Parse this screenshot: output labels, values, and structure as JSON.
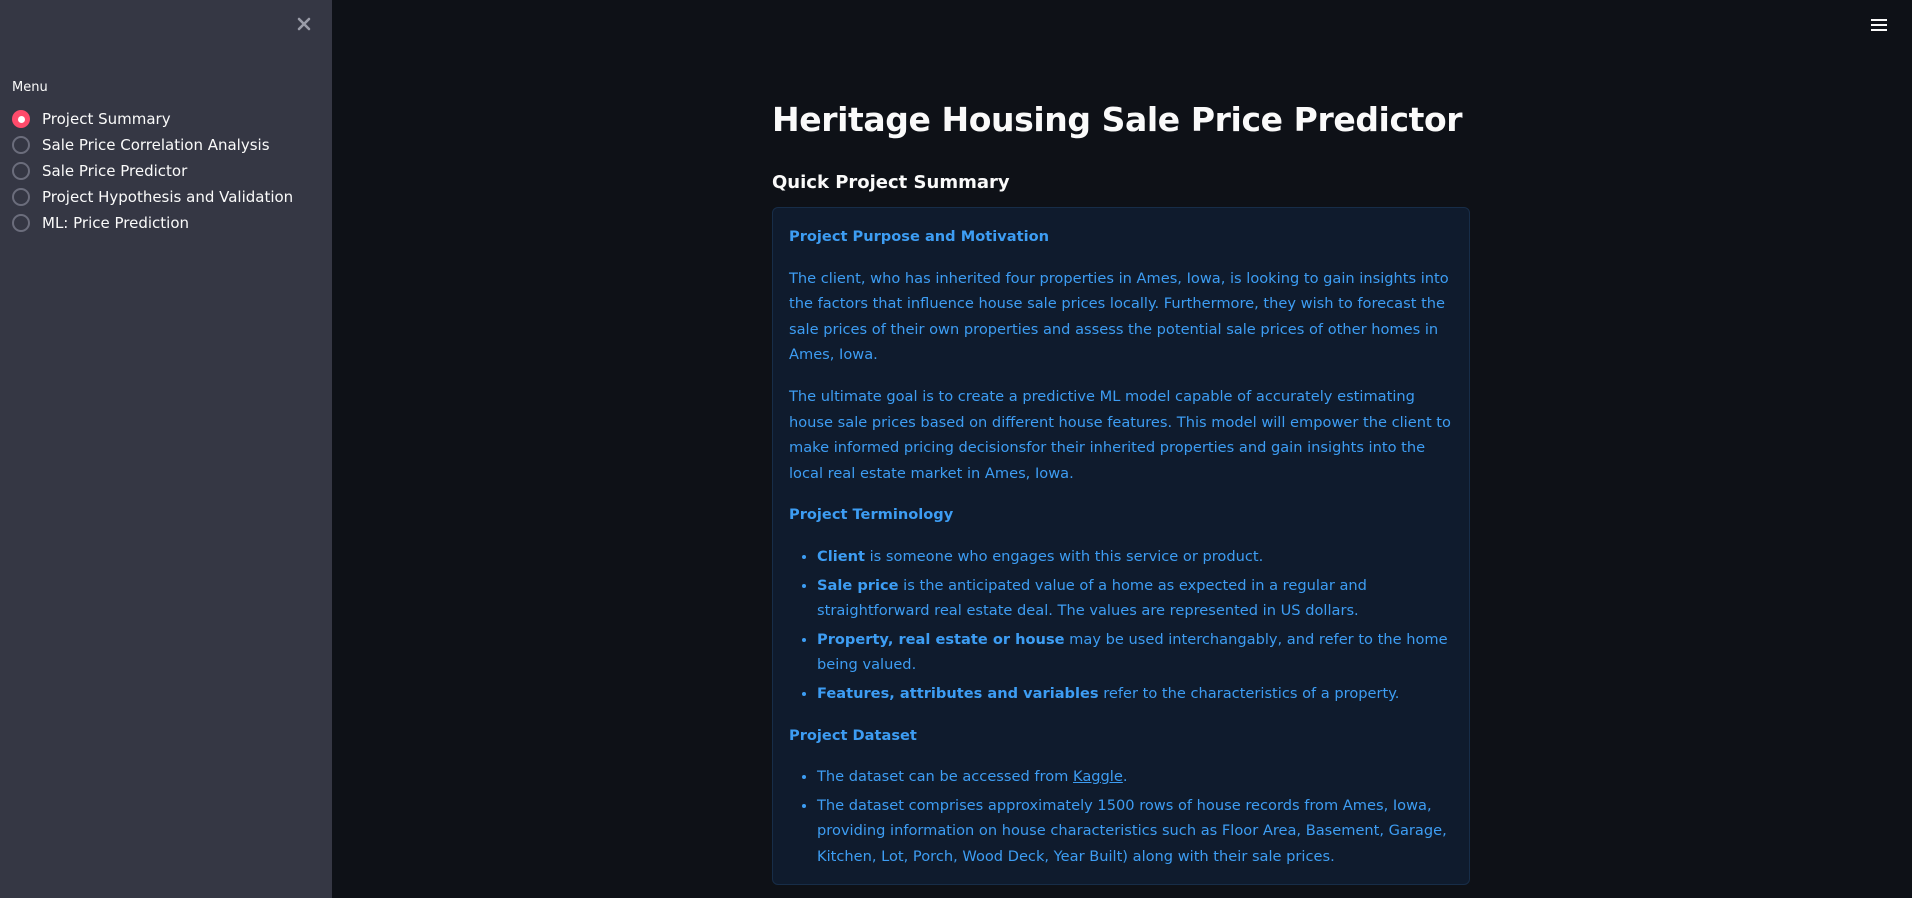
{
  "sidebar": {
    "menu_label": "Menu",
    "close_icon": "close-icon",
    "items": [
      {
        "label": "Project Summary",
        "selected": true
      },
      {
        "label": "Sale Price Correlation Analysis",
        "selected": false
      },
      {
        "label": "Sale Price Predictor",
        "selected": false
      },
      {
        "label": "Project Hypothesis and Validation",
        "selected": false
      },
      {
        "label": "ML: Price Prediction",
        "selected": false
      }
    ]
  },
  "header": {
    "menu_icon": "hamburger-menu-icon"
  },
  "main": {
    "title": "Heritage Housing Sale Price Predictor",
    "subtitle": "Quick Project Summary",
    "purpose": {
      "heading": "Project Purpose and Motivation",
      "paragraph1": "The client, who has inherited four properties in Ames, Iowa, is looking to gain insights into the factors that influence house sale prices locally. Furthermore, they wish to forecast the sale prices of their own properties and assess the potential sale prices of other homes in Ames, Iowa.",
      "paragraph2": "The ultimate goal is to create a predictive ML model capable of accurately estimating house sale prices based on different house features. This model will empower the client to make informed pricing decisionsfor their inherited properties and gain insights into the local real estate market in Ames, Iowa."
    },
    "terminology": {
      "heading": "Project Terminology",
      "items": [
        {
          "term": "Client",
          "text": " is someone who engages with this service or product."
        },
        {
          "term": "Sale price",
          "text": " is the anticipated value of a home as expected in a regular and straightforward real estate deal. The values are represented in US dollars."
        },
        {
          "term": "Property, real estate or house",
          "text": " may be used interchangably, and refer to the home being valued."
        },
        {
          "term": "Features, attributes and variables",
          "text": " refer to the characteristics of a property."
        }
      ]
    },
    "dataset": {
      "heading": "Project Dataset",
      "item1_prefix": "The dataset can be accessed from ",
      "item1_link": "Kaggle",
      "item1_suffix": ".",
      "item2": "The dataset comprises approximately 1500 rows of house records from Ames, Iowa, providing information on house characteristics such as Floor Area, Basement, Garage, Kitchen, Lot, Porch, Wood Deck, Year Built) along with their sale prices."
    }
  },
  "colors": {
    "sidebar_bg": "#353744",
    "main_bg": "#0e1117",
    "accent": "#ff4b6b",
    "info_text": "#3d9df3",
    "info_bg": "#0f1b2d"
  }
}
